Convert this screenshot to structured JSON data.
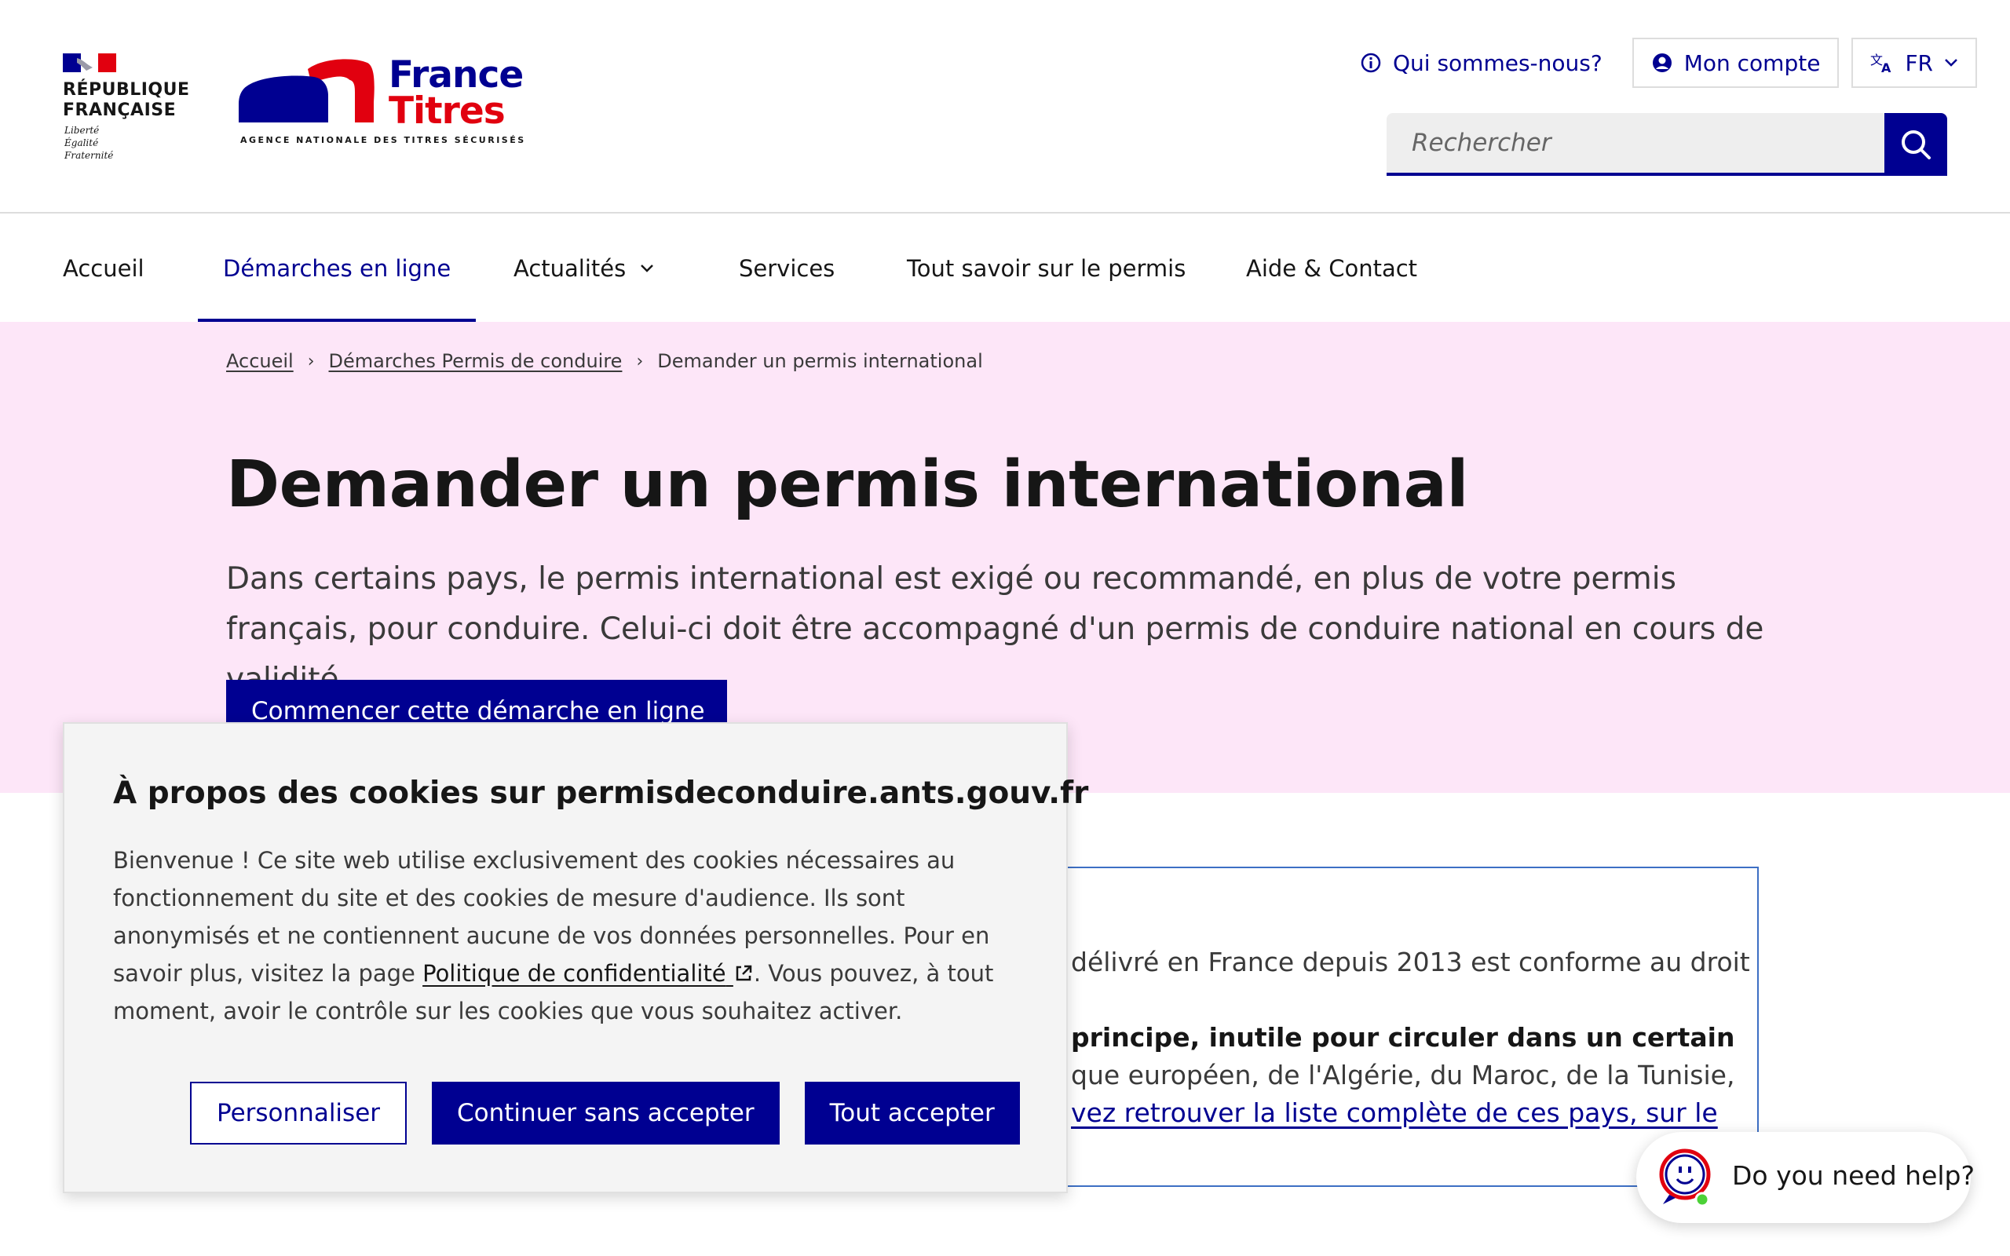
{
  "header": {
    "republique": "RÉPUBLIQUE\nFRANÇAISE",
    "motto": "Liberté\nÉgalité\nFraternité",
    "brand_line1": "France",
    "brand_line2": "Titres",
    "brand_agency": "AGENCE NATIONALE DES TITRES SÉCURISÉS",
    "tools": {
      "about": "Qui sommes-nous?",
      "account": "Mon compte",
      "lang": "FR"
    },
    "search_placeholder": "Rechercher"
  },
  "nav": {
    "items": [
      {
        "label": "Accueil"
      },
      {
        "label": "Démarches en ligne"
      },
      {
        "label": "Actualités"
      },
      {
        "label": "Services"
      },
      {
        "label": "Tout savoir sur le permis"
      },
      {
        "label": "Aide & Contact"
      }
    ],
    "active": "Démarches en ligne"
  },
  "breadcrumb": {
    "items": [
      "Accueil",
      "Démarches Permis de conduire",
      "Demander un permis international"
    ]
  },
  "hero": {
    "title": "Demander un permis international",
    "lead": "Dans certains pays, le permis international est exigé ou recommandé, en plus de votre permis français, pour conduire. Celui-ci doit être accompagné d'un permis de conduire national en cours de validité",
    "cta": "Commencer cette démarche en ligne"
  },
  "callout": {
    "p1": "délivré en France depuis 2013 est conforme au droit",
    "p2": "principe, inutile pour circuler dans un certain",
    "p3": "que européen, de l'Algérie, du Maroc, de la Tunisie,",
    "p4": "vez retrouver la liste complète de ces pays, sur le"
  },
  "cookie": {
    "title": "À propos des cookies sur permisdeconduire.ants.gouv.fr",
    "text_before": "Bienvenue ! Ce site web utilise exclusivement des cookies nécessaires au fonctionnement du site et des cookies de mesure d'audience. Ils sont anonymisés et ne contiennent aucune de vos données personnelles. Pour en savoir plus, visitez la page ",
    "link": "Politique de confidentialité",
    "text_after": ". Vous pouvez, à tout moment, avoir le contrôle sur les cookies que vous souhaitez activer.",
    "buttons": {
      "customize": "Personnaliser",
      "refuse": "Continuer sans accepter",
      "accept": "Tout accepter"
    }
  },
  "help": {
    "label": "Do you need help?",
    "status_color": "#4cd137"
  },
  "colors": {
    "primary": "#000091",
    "accent_red": "#e1000f",
    "hero_bg": "#fde6f8"
  }
}
